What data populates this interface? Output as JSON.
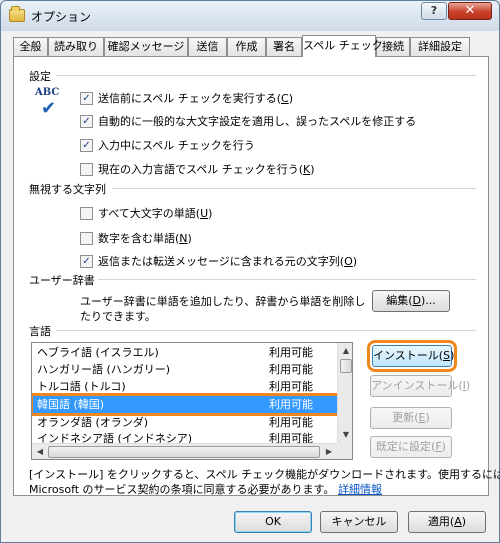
{
  "window": {
    "title": "オプション",
    "help_label": "?",
    "close_label": "✕"
  },
  "tabs": [
    {
      "label": "全般"
    },
    {
      "label": "読み取り"
    },
    {
      "label": "確認メッセージ"
    },
    {
      "label": "送信"
    },
    {
      "label": "作成"
    },
    {
      "label": "署名"
    },
    {
      "label": "スペル チェック"
    },
    {
      "label": "接続"
    },
    {
      "label": "詳細設定"
    }
  ],
  "active_tab": "スペル チェック",
  "settings": {
    "label": "設定",
    "icon_text": "ABC",
    "options": [
      {
        "text": "送信前にスペル チェックを実行する(",
        "key": "C",
        "tail": ")",
        "checked": true
      },
      {
        "text": "自動的に一般的な大文字設定を適用し、誤ったスペルを修正する",
        "key": "",
        "tail": "",
        "checked": true
      },
      {
        "text": "入力中にスペル チェックを行う",
        "key": "",
        "tail": "",
        "checked": true
      },
      {
        "text": "現在の入力言語でスペル チェックを行う(",
        "key": "K",
        "tail": ")",
        "checked": false
      }
    ]
  },
  "ignore": {
    "label": "無視する文字列",
    "options": [
      {
        "text": "すべて大文字の単語(",
        "key": "U",
        "tail": ")",
        "checked": false
      },
      {
        "text": "数字を含む単語(",
        "key": "N",
        "tail": ")",
        "checked": false
      },
      {
        "text": "返信または転送メッセージに含まれる元の文字列(",
        "key": "O",
        "tail": ")",
        "checked": true
      }
    ]
  },
  "user_dictionary": {
    "label": "ユーザー辞書",
    "description_line1": "ユーザー辞書に単語を追加したり、辞書から単語を削除し",
    "description_line2": "たりできます。",
    "edit_label": "編集(",
    "edit_key": "D",
    "edit_tail": ")..."
  },
  "languages": {
    "label": "言語",
    "rows": [
      {
        "name": "ヘブライ語 (イスラエル)",
        "status": "利用可能",
        "selected": false
      },
      {
        "name": "ハンガリー語 (ハンガリー)",
        "status": "利用可能",
        "selected": false
      },
      {
        "name": "トルコ語 (トルコ)",
        "status": "利用可能",
        "selected": false
      },
      {
        "name": "韓国語 (韓国)",
        "status": "利用可能",
        "selected": true
      },
      {
        "name": "オランダ語 (オランダ)",
        "status": "利用可能",
        "selected": false
      },
      {
        "name": "インドネシア語 (インドネシア)",
        "status": "利用可能",
        "selected": false
      }
    ],
    "install": {
      "label": "インストール(",
      "key": "S",
      "tail": ")"
    },
    "uninstall": {
      "label": "アンインストール(",
      "key": "I",
      "tail": ")"
    },
    "update": {
      "label": "更新(",
      "key": "E",
      "tail": ")"
    },
    "default": {
      "label": "既定に設定(",
      "key": "F",
      "tail": ")"
    }
  },
  "footer": {
    "line1": "[インストール] をクリックすると、スペル チェック機能がダウンロードされます。使用するには、",
    "line2": "Microsoft のサービス契約の条項に同意する必要があります。",
    "link": "詳細情報"
  },
  "buttons": {
    "ok": "OK",
    "cancel": "キャンセル",
    "apply": "適用(",
    "apply_key": "A",
    "apply_tail": ")"
  },
  "colors": {
    "selection": "#3399ff",
    "highlight": "#f0871e",
    "link": "#0a56c2"
  }
}
